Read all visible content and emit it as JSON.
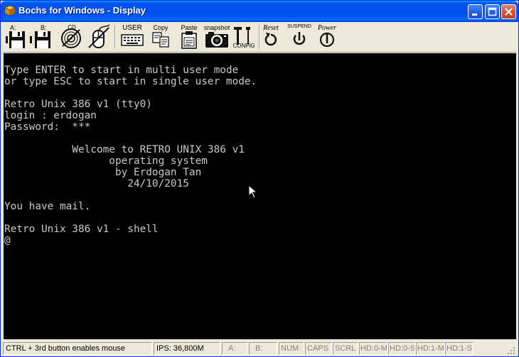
{
  "window": {
    "title": "Bochs for Windows - Display",
    "app_icon": "bochs-icon",
    "controls": [
      "minimize-icon",
      "maximize-icon",
      "close-icon"
    ]
  },
  "toolbar": {
    "floppy_a": "A:",
    "floppy_b": "B:",
    "cdrom": "CD",
    "mouse": "",
    "user": "USER",
    "copy": "Copy",
    "paste": "Paste",
    "snapshot": "snapshot",
    "config": "CONFIG",
    "reset": "Reset",
    "suspend": "SUSPEND",
    "power": "Power"
  },
  "screen": {
    "lines": [
      "Type ENTER to start in multi user mode",
      "or type ESC to start in single user mode.",
      "",
      "Retro Unix 386 v1 (tty0)",
      "login : erdogan",
      "Password:  ***",
      "",
      "           Welcome to RETRO UNIX 386 v1",
      "                 operating system",
      "                  by Erdogan Tan",
      "                    24/10/2015",
      "",
      "You have mail.",
      "",
      "Retro Unix 386 v1 - shell",
      "@"
    ]
  },
  "statusbar": {
    "hint": "CTRL + 3rd button enables mouse",
    "ips": "IPS: 36,800M",
    "a": "A:",
    "b": "B:",
    "num": "NUM",
    "caps": "CAPS",
    "scrl": "SCRL",
    "hd00m": "HD:0-M",
    "hd00s": "HD:0-S",
    "hd1m": "HD:1-M",
    "hd1s": "HD:1-S"
  }
}
